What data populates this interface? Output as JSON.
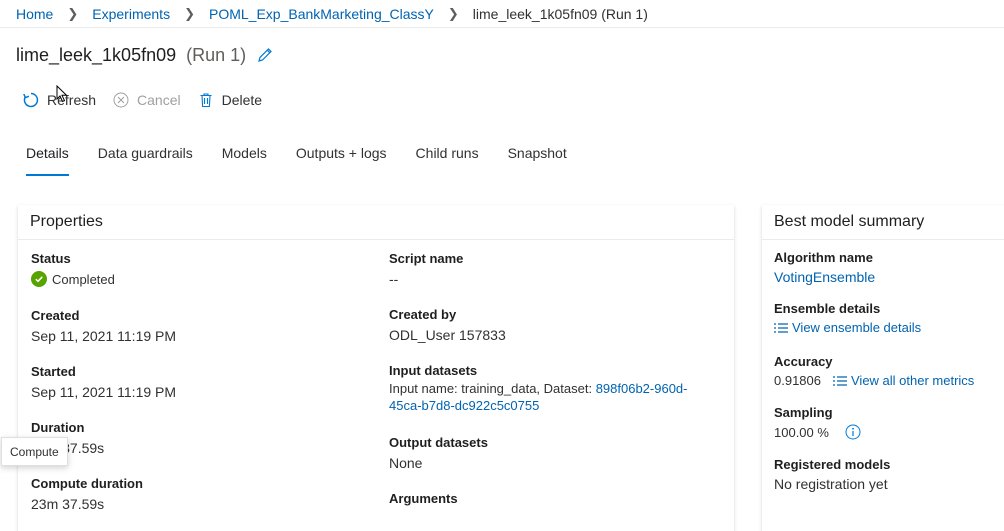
{
  "breadcrumb": {
    "items": [
      "Home",
      "Experiments",
      "POML_Exp_BankMarketing_ClassY"
    ],
    "current": "lime_leek_1k05fn09 (Run 1)"
  },
  "title": {
    "name": "lime_leek_1k05fn09",
    "run": "(Run 1)"
  },
  "commands": {
    "refresh": "Refresh",
    "cancel": "Cancel",
    "delete": "Delete"
  },
  "tabs": [
    "Details",
    "Data guardrails",
    "Models",
    "Outputs + logs",
    "Child runs",
    "Snapshot"
  ],
  "properties": {
    "title": "Properties",
    "status": {
      "label": "Status",
      "value": "Completed"
    },
    "created": {
      "label": "Created",
      "value": "Sep 11, 2021 11:19 PM"
    },
    "started": {
      "label": "Started",
      "value": "Sep 11, 2021 11:19 PM"
    },
    "duration": {
      "label": "Duration",
      "value": "23m 37.59s"
    },
    "compute_duration": {
      "label": "Compute duration",
      "value": "23m 37.59s"
    },
    "script_name": {
      "label": "Script name",
      "value": "--"
    },
    "created_by": {
      "label": "Created by",
      "value": "ODL_User 157833"
    },
    "input_datasets": {
      "label": "Input datasets",
      "prefix": "Input name: training_data, Dataset: ",
      "link_line1": "898f06b2-960d-",
      "link_line2": "45ca-b7d8-dc922c5c0755"
    },
    "output_datasets": {
      "label": "Output datasets",
      "value": "None"
    },
    "arguments": {
      "label": "Arguments"
    }
  },
  "best_model": {
    "title": "Best model summary",
    "algorithm": {
      "label": "Algorithm name",
      "value": "VotingEnsemble"
    },
    "ensemble": {
      "label": "Ensemble details",
      "link": "View ensemble details"
    },
    "accuracy": {
      "label": "Accuracy",
      "value": "0.91806",
      "link": "View all other metrics"
    },
    "sampling": {
      "label": "Sampling",
      "value": "100.00 %"
    },
    "registered": {
      "label": "Registered models",
      "value": "No registration yet"
    }
  },
  "tooltip": "Compute",
  "colors": {
    "accent": "#0078d4",
    "link": "#0063b1",
    "success": "#57a300"
  }
}
